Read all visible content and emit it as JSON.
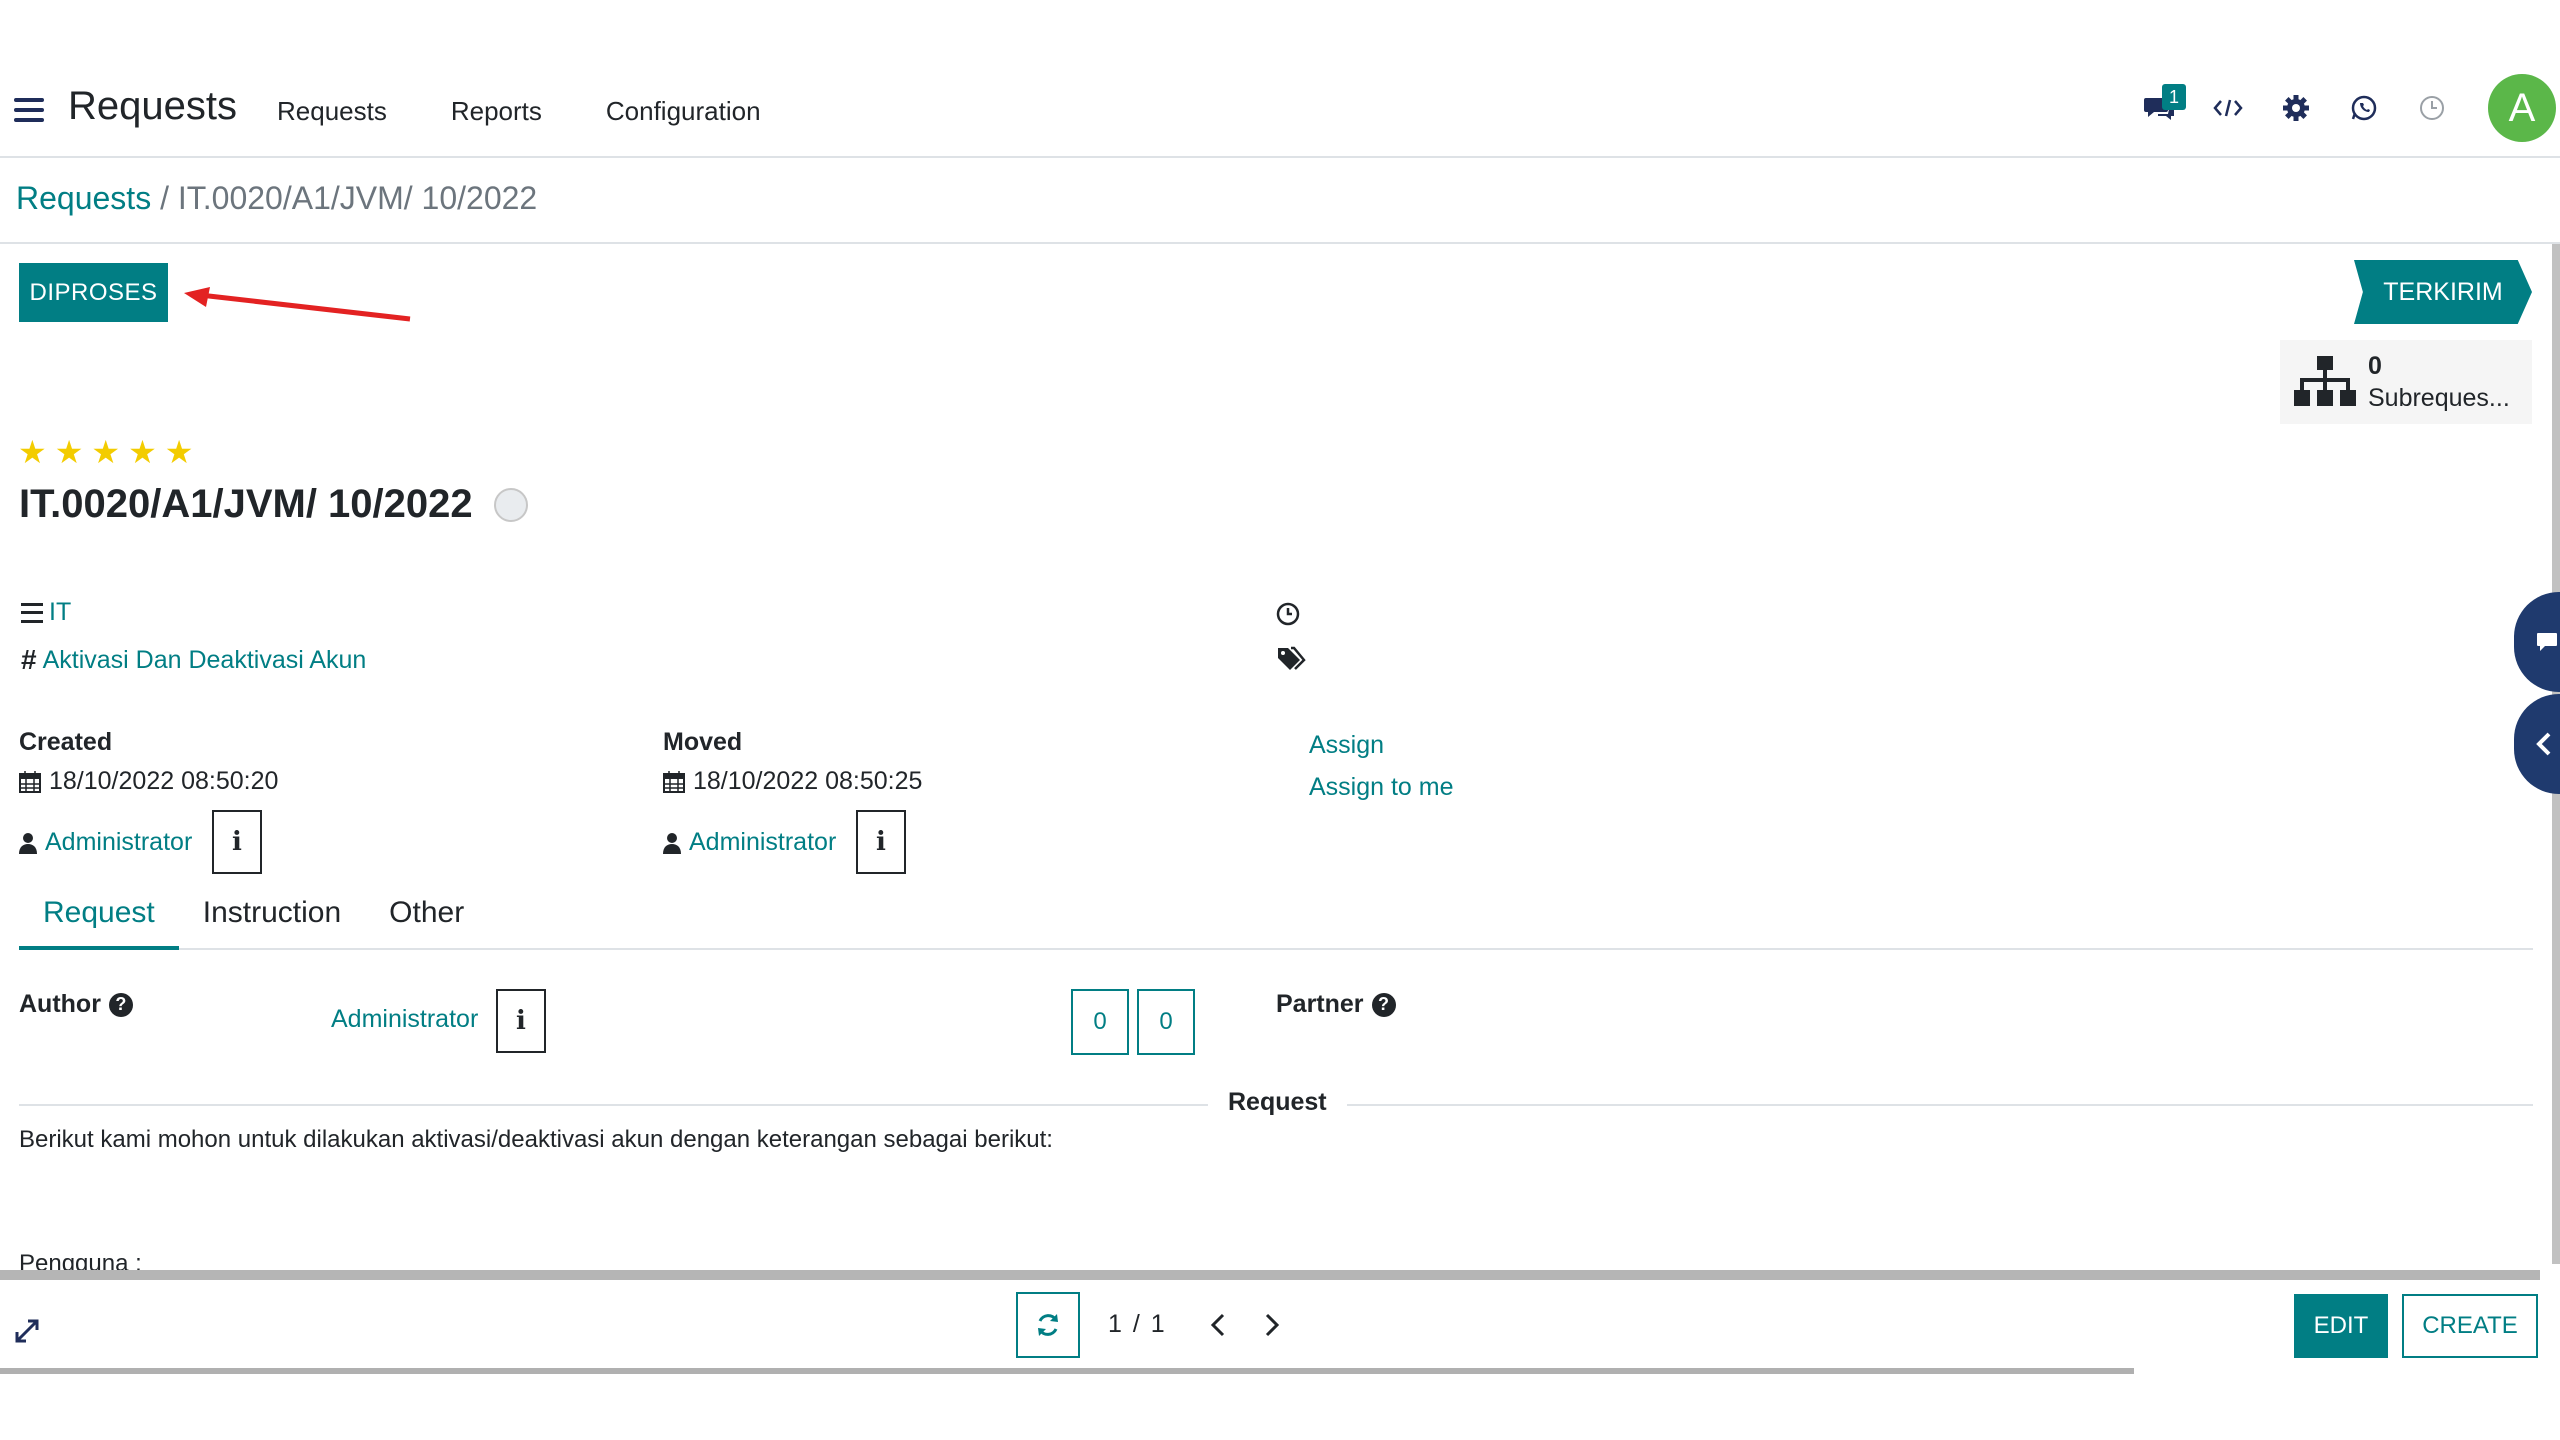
{
  "navbar": {
    "app_title": "Requests",
    "menu": [
      "Requests",
      "Reports",
      "Configuration"
    ],
    "chat_badge": "1",
    "avatar_letter": "A"
  },
  "breadcrumb": {
    "parent": "Requests",
    "separator": " / ",
    "current": "IT.0020/A1/JVM/ 10/2022"
  },
  "statusbar": {
    "action_button": "DIPROSES",
    "stage": "TERKIRIM"
  },
  "smart_button": {
    "count": "0",
    "label": "Subreques..."
  },
  "record": {
    "priority_stars": 5,
    "title": "IT.0020/A1/JVM/ 10/2022",
    "category": "IT",
    "type": "Aktivasi Dan Deaktivasi Akun"
  },
  "created": {
    "label": "Created",
    "datetime": "18/10/2022 08:50:20",
    "user": "Administrator"
  },
  "moved": {
    "label": "Moved",
    "datetime": "18/10/2022 08:50:25",
    "user": "Administrator"
  },
  "assign": {
    "assign_label": "Assign",
    "assign_me_label": "Assign to me"
  },
  "tabs": [
    "Request",
    "Instruction",
    "Other"
  ],
  "request_tab": {
    "author_label": "Author",
    "author_value": "Administrator",
    "counter_1": "0",
    "counter_2": "0",
    "partner_label": "Partner",
    "section_title": "Request",
    "text_line_1": "Berikut kami mohon untuk dilakukan aktivasi/deaktivasi akun dengan keterangan sebagai berikut:",
    "text_line_2": "Pengguna  :"
  },
  "pager": {
    "value": "1 / 1"
  },
  "buttons": {
    "edit": "EDIT",
    "create": "CREATE"
  },
  "colors": {
    "primary": "#017e84",
    "navy": "#1f3a6e",
    "star": "#f3cc00",
    "avatar": "#5bb749",
    "annotation_arrow": "#e32222"
  }
}
